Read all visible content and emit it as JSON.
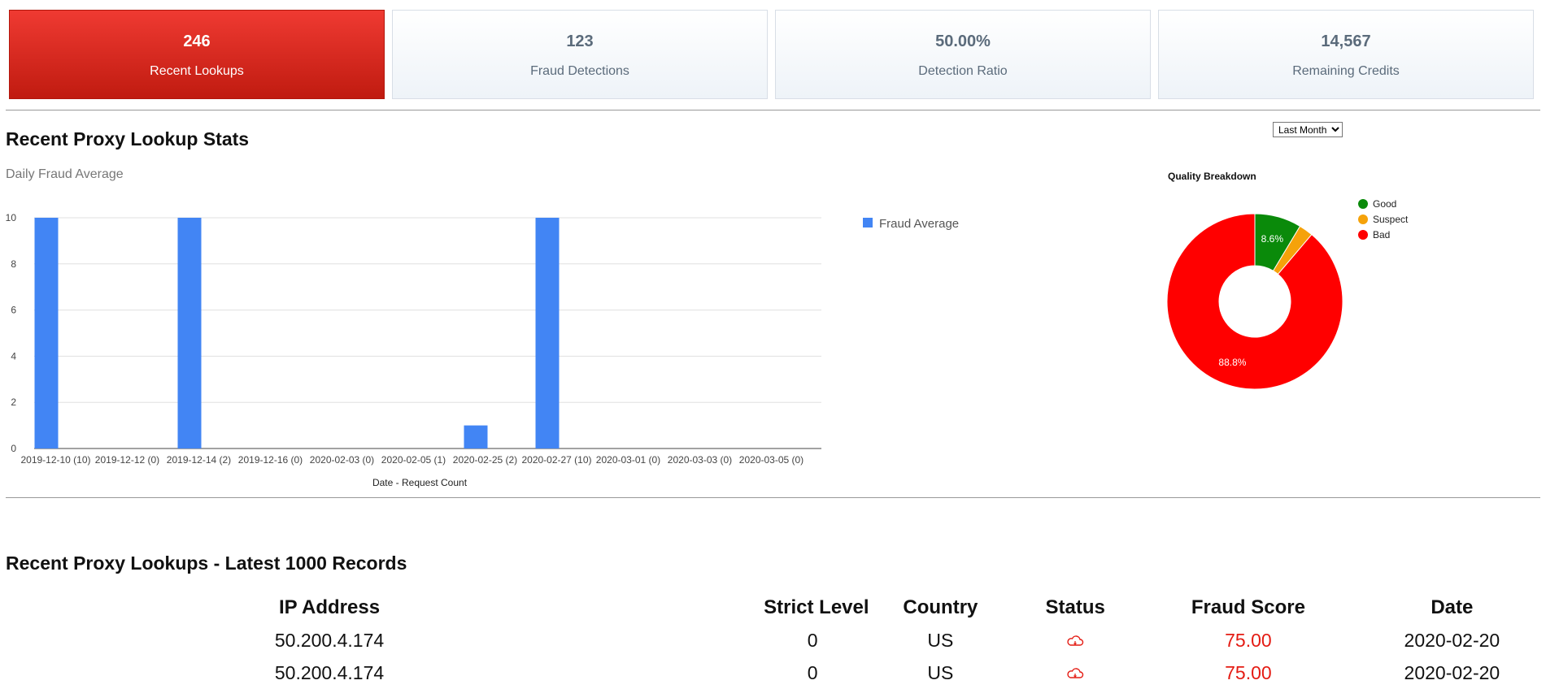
{
  "stats": [
    {
      "value": "246",
      "label": "Recent Lookups",
      "active": true
    },
    {
      "value": "123",
      "label": "Fraud Detections",
      "active": false
    },
    {
      "value": "50.00%",
      "label": "Detection Ratio",
      "active": false
    },
    {
      "value": "14,567",
      "label": "Remaining Credits",
      "active": false
    }
  ],
  "stats_section": {
    "title": "Recent Proxy Lookup Stats",
    "subtitle": "Daily Fraud Average",
    "range_selected": "Last Month"
  },
  "colors": {
    "accent": "#d92b20",
    "bar": "#4285f4",
    "good": "#0a8a0a",
    "suspect": "#f5a20a",
    "bad": "#ff0000",
    "score": "#e41b13"
  },
  "chart_data": [
    {
      "type": "bar",
      "categories": [
        "2019-12-10 (10)",
        "2019-12-12 (0)",
        "2019-12-14 (2)",
        "2019-12-16 (0)",
        "2020-02-03 (0)",
        "2020-02-05 (1)",
        "2020-02-25 (2)",
        "2020-02-27 (10)",
        "2020-03-01 (0)",
        "2020-03-03 (0)",
        "2020-03-05 (0)"
      ],
      "series": [
        {
          "name": "Fraud Average",
          "values": [
            10,
            0,
            10,
            0,
            0,
            0,
            1,
            10,
            0,
            0,
            0
          ]
        }
      ],
      "xlabel": "Date - Request Count",
      "ylabel": "",
      "ylim": [
        0,
        10
      ],
      "yticks": [
        0,
        2,
        4,
        6,
        8,
        10
      ],
      "grid": true,
      "legend": "right"
    },
    {
      "type": "pie",
      "title": "Quality Breakdown",
      "donut": true,
      "labels": [
        "Good",
        "Suspect",
        "Bad"
      ],
      "values": [
        8.6,
        2.6,
        88.8
      ],
      "slice_labels": [
        "8.6%",
        "",
        "88.8%"
      ],
      "legend": "right"
    }
  ],
  "lookups": {
    "title": "Recent Proxy Lookups - Latest 1000 Records",
    "columns": [
      "IP Address",
      "Strict Level",
      "Country",
      "Status",
      "Fraud Score",
      "Date"
    ],
    "rows": [
      {
        "ip": "50.200.4.174",
        "strict": "0",
        "country": "US",
        "status_icon": "cloud-icon",
        "score": "75.00",
        "date": "2020-02-20"
      },
      {
        "ip": "50.200.4.174",
        "strict": "0",
        "country": "US",
        "status_icon": "cloud-icon",
        "score": "75.00",
        "date": "2020-02-20"
      }
    ]
  }
}
